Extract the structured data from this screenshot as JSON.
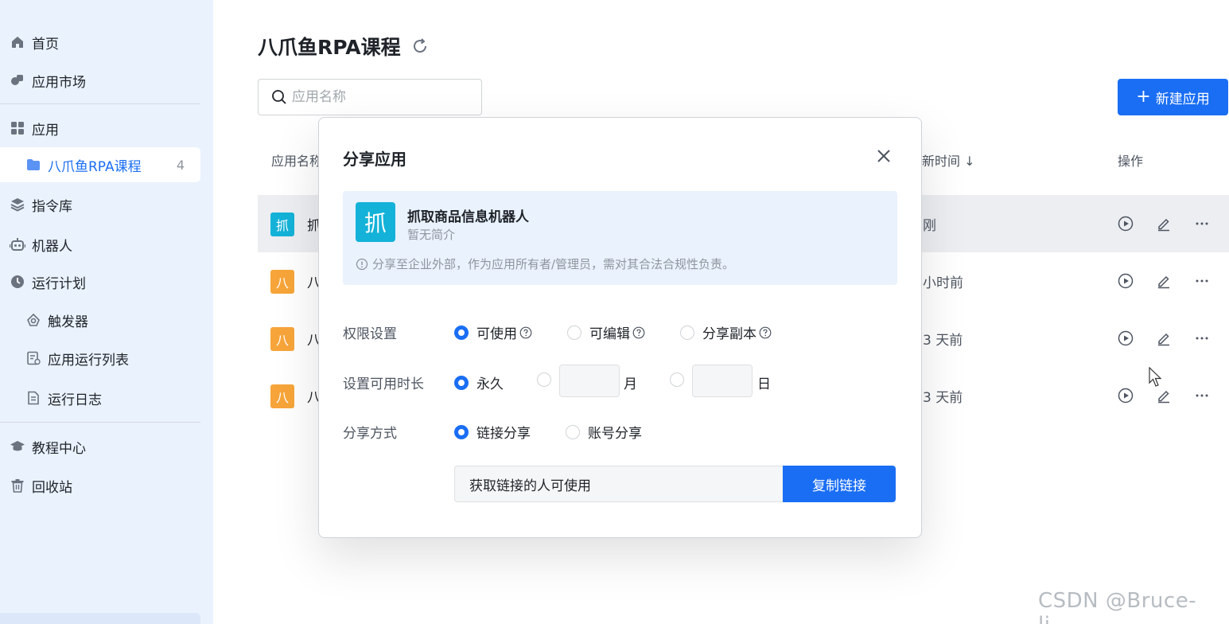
{
  "sidebar": {
    "items": [
      {
        "label": "首页",
        "icon": "home-icon"
      },
      {
        "label": "应用市场",
        "icon": "market-icon"
      },
      {
        "label": "应用",
        "icon": "apps-grid-icon"
      },
      {
        "label": "八爪鱼RPA课程",
        "icon": "folder-icon",
        "count": "4"
      },
      {
        "label": "指令库",
        "icon": "layers-icon"
      },
      {
        "label": "机器人",
        "icon": "robot-icon"
      },
      {
        "label": "运行计划",
        "icon": "clock-icon"
      },
      {
        "label": "触发器",
        "icon": "trigger-icon"
      },
      {
        "label": "应用运行列表",
        "icon": "run-list-icon"
      },
      {
        "label": "运行日志",
        "icon": "log-icon"
      },
      {
        "label": "教程中心",
        "icon": "graduation-cap-icon"
      },
      {
        "label": "回收站",
        "icon": "trash-icon"
      }
    ]
  },
  "main": {
    "title": "八爪鱼RPA课程",
    "search_placeholder": "应用名称",
    "new_app_label": "新建应用",
    "table": {
      "col_name": "应用名称",
      "col_updated": "新时间 ↓",
      "col_actions": "操作",
      "rows": [
        {
          "tile": "抓",
          "tile_color": "#14b2d8",
          "name": "抓",
          "updated": "刚"
        },
        {
          "tile": "八",
          "tile_color": "#f7a53a",
          "name": "八",
          "updated": "小时前"
        },
        {
          "tile": "八",
          "tile_color": "#f7a53a",
          "name": "八",
          "updated": "3 天前"
        },
        {
          "tile": "八",
          "tile_color": "#f7a53a",
          "name": "八",
          "updated": "3 天前"
        }
      ]
    }
  },
  "modal": {
    "title": "分享应用",
    "app_tile": "抓",
    "app_name": "抓取商品信息机器人",
    "app_desc": "暂无简介",
    "notice": "分享至企业外部，作为应用所有者/管理员，需对其合法合规性负责。",
    "permission_label": "权限设置",
    "permission_options": [
      "可使用",
      "可编辑",
      "分享副本"
    ],
    "duration_label": "设置可用时长",
    "duration_forever": "永久",
    "duration_month_unit": "月",
    "duration_day_unit": "日",
    "share_method_label": "分享方式",
    "share_methods": [
      "链接分享",
      "账号分享"
    ],
    "link_text": "获取链接的人可使用",
    "copy_label": "复制链接"
  },
  "watermark": "CSDN @Bruce-li__",
  "colors": {
    "accent": "#1a6ef4",
    "sidebar_bg": "#eaf2fd",
    "tile_cyan": "#14b2d8",
    "tile_orange": "#f7a53a"
  }
}
